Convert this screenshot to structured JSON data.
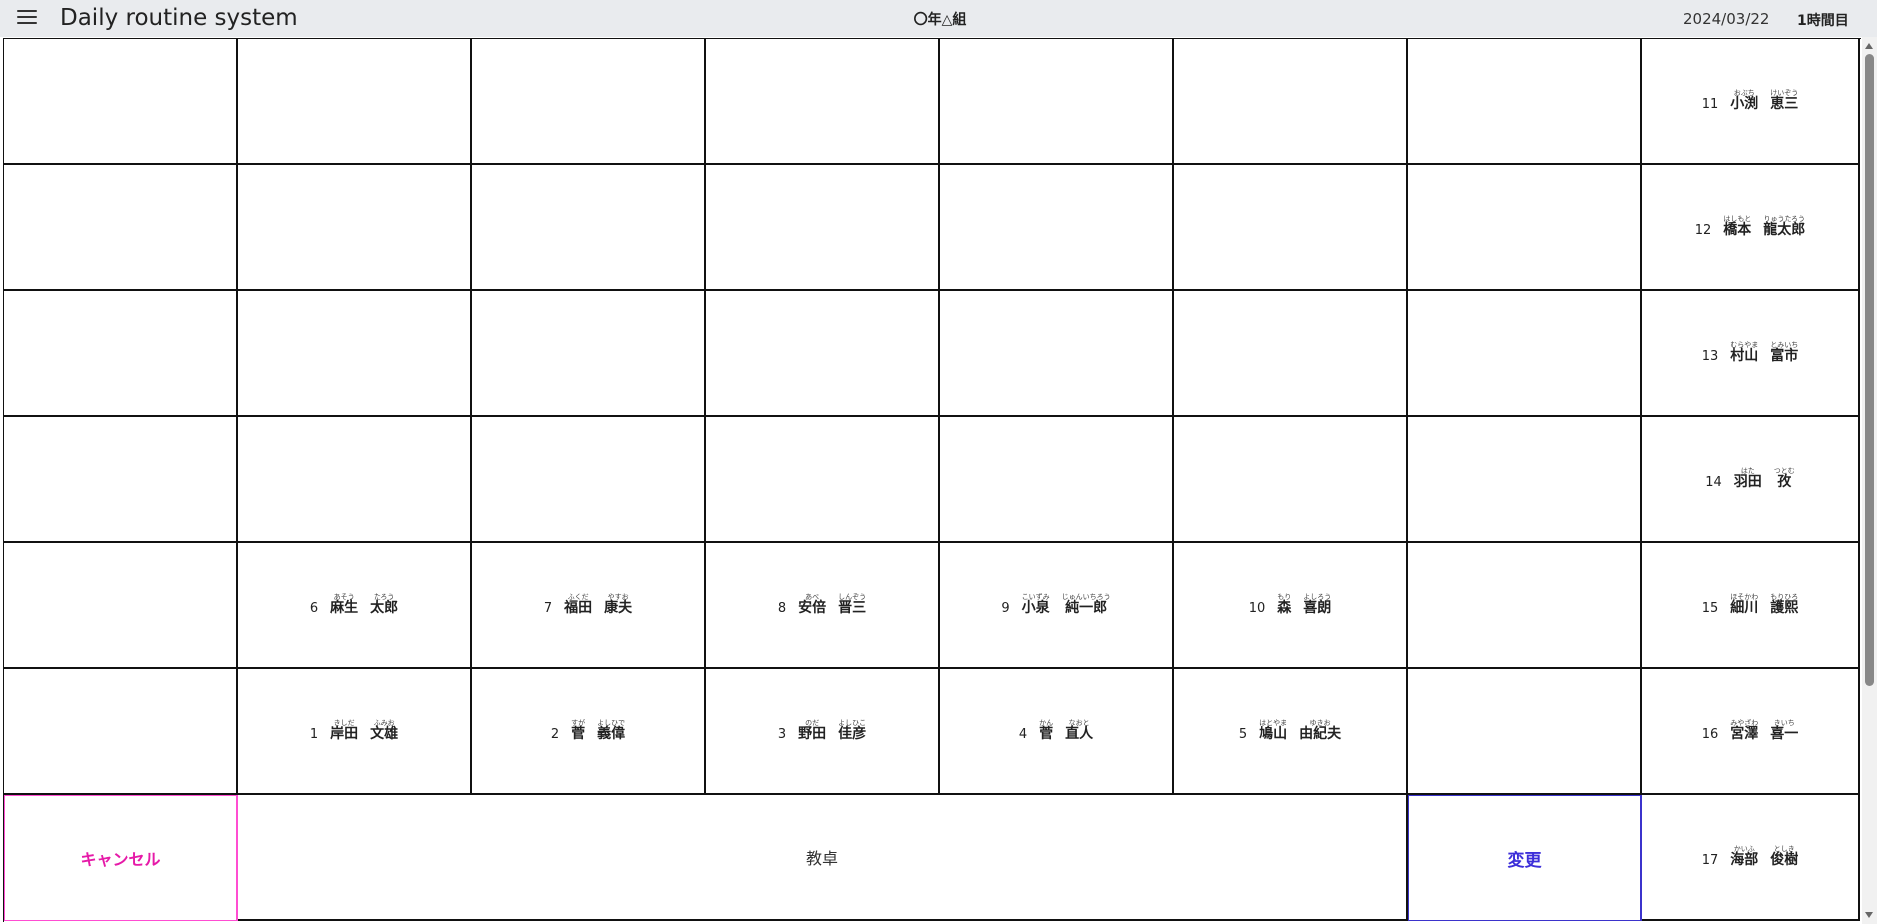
{
  "header": {
    "menu_icon": "hamburger-menu-icon",
    "title": "Daily routine system",
    "class_name": "〇年△組",
    "date": "2024/03/22",
    "period": "1時間目"
  },
  "seating": {
    "rows": [
      [
        null,
        null,
        null,
        null,
        null,
        null,
        null,
        {
          "num": "11",
          "family": "小渕",
          "family_kana": "おぶち",
          "given": "恵三",
          "given_kana": "けいぞう"
        }
      ],
      [
        null,
        null,
        null,
        null,
        null,
        null,
        null,
        {
          "num": "12",
          "family": "橋本",
          "family_kana": "はしもと",
          "given": "龍太郎",
          "given_kana": "りゅうたろう"
        }
      ],
      [
        null,
        null,
        null,
        null,
        null,
        null,
        null,
        {
          "num": "13",
          "family": "村山",
          "family_kana": "むらやま",
          "given": "富市",
          "given_kana": "とみいち"
        }
      ],
      [
        null,
        null,
        null,
        null,
        null,
        null,
        null,
        {
          "num": "14",
          "family": "羽田",
          "family_kana": "はた",
          "given": "孜",
          "given_kana": "つとむ"
        }
      ],
      [
        null,
        {
          "num": "6",
          "family": "麻生",
          "family_kana": "あそう",
          "given": "太郎",
          "given_kana": "たろう"
        },
        {
          "num": "7",
          "family": "福田",
          "family_kana": "ふくだ",
          "given": "康夫",
          "given_kana": "やすお"
        },
        {
          "num": "8",
          "family": "安倍",
          "family_kana": "あべ",
          "given": "晋三",
          "given_kana": "しんぞう"
        },
        {
          "num": "9",
          "family": "小泉",
          "family_kana": "こいずみ",
          "given": "純一郎",
          "given_kana": "じゅんいちろう"
        },
        {
          "num": "10",
          "family": "森",
          "family_kana": "もり",
          "given": "喜朗",
          "given_kana": "よしろう"
        },
        null,
        {
          "num": "15",
          "family": "細川",
          "family_kana": "ほそかわ",
          "given": "護熙",
          "given_kana": "もりひろ"
        }
      ],
      [
        null,
        {
          "num": "1",
          "family": "岸田",
          "family_kana": "きしだ",
          "given": "文雄",
          "given_kana": "ふみお"
        },
        {
          "num": "2",
          "family": "菅",
          "family_kana": "すが",
          "given": "義偉",
          "given_kana": "よしひで"
        },
        {
          "num": "3",
          "family": "野田",
          "family_kana": "のだ",
          "given": "佳彦",
          "given_kana": "よしひこ"
        },
        {
          "num": "4",
          "family": "菅",
          "family_kana": "かん",
          "given": "直人",
          "given_kana": "なおと"
        },
        {
          "num": "5",
          "family": "鳩山",
          "family_kana": "はとやま",
          "given": "由紀夫",
          "given_kana": "ゆきお"
        },
        null,
        {
          "num": "16",
          "family": "宮澤",
          "family_kana": "みやざわ",
          "given": "喜一",
          "given_kana": "きいち"
        }
      ]
    ],
    "last_row_student": {
      "num": "17",
      "family": "海部",
      "family_kana": "かいふ",
      "given": "俊樹",
      "given_kana": "としき"
    }
  },
  "actions": {
    "cancel_label": "キャンセル",
    "cancel_color": "#e61aa8",
    "desk_label": "教卓",
    "change_label": "変更",
    "change_color": "#3d2fd9"
  }
}
